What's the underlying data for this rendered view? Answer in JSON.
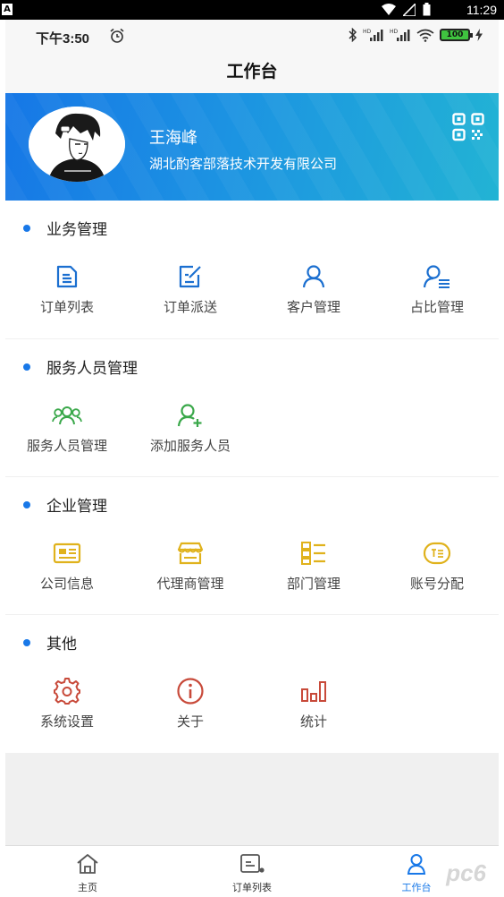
{
  "system_bar": {
    "badge": "A",
    "time": "11:29"
  },
  "phone_status": {
    "time": "下午3:50",
    "battery": "100"
  },
  "title": "工作台",
  "profile": {
    "name": "王海峰",
    "company": "湖北酌客部落技术开发有限公司"
  },
  "sections": {
    "business": {
      "title": "业务管理",
      "items": [
        "订单列表",
        "订单派送",
        "客户管理",
        "占比管理"
      ]
    },
    "staff": {
      "title": "服务人员管理",
      "items": [
        "服务人员管理",
        "添加服务人员"
      ]
    },
    "enterprise": {
      "title": "企业管理",
      "items": [
        "公司信息",
        "代理商管理",
        "部门管理",
        "账号分配"
      ]
    },
    "other": {
      "title": "其他",
      "items": [
        "系统设置",
        "关于",
        "统计"
      ]
    }
  },
  "colors": {
    "accent": "#1878e8",
    "business": "#1b6fd0",
    "staff": "#3aa84a",
    "enterprise": "#e0b21c",
    "other": "#c84a3a"
  },
  "tabs": [
    {
      "label": "主页",
      "icon": "home-icon"
    },
    {
      "label": "订单列表",
      "icon": "order-list-icon"
    },
    {
      "label": "工作台",
      "icon": "user-icon"
    }
  ],
  "watermark": "pc6"
}
